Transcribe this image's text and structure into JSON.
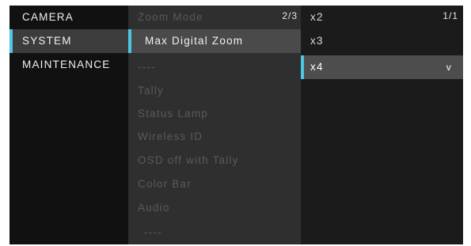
{
  "main_menu": {
    "items": [
      {
        "label": "CAMERA"
      },
      {
        "label": "SYSTEM"
      },
      {
        "label": "MAINTENANCE"
      }
    ],
    "selected_index": 1
  },
  "sub_menu": {
    "page_indicator": "2/3",
    "items": [
      {
        "label": "Zoom Mode"
      },
      {
        "label": "Max Digital Zoom"
      },
      {
        "label": "----"
      },
      {
        "label": "Tally"
      },
      {
        "label": "Status Lamp"
      },
      {
        "label": "Wireless ID"
      },
      {
        "label": "OSD off with Tally"
      },
      {
        "label": "Color Bar"
      },
      {
        "label": "Audio"
      },
      {
        "label": "----"
      }
    ],
    "selected_index": 1
  },
  "options": {
    "page_indicator": "1/1",
    "items": [
      {
        "label": "x2"
      },
      {
        "label": "x3"
      },
      {
        "label": "x4",
        "check": "v"
      }
    ],
    "selected_index": 2
  },
  "colors": {
    "accent": "#4cc6e2",
    "background": "#111111",
    "sub_panel": "#2f2f2f",
    "selected_row": "#4a4a4a"
  }
}
